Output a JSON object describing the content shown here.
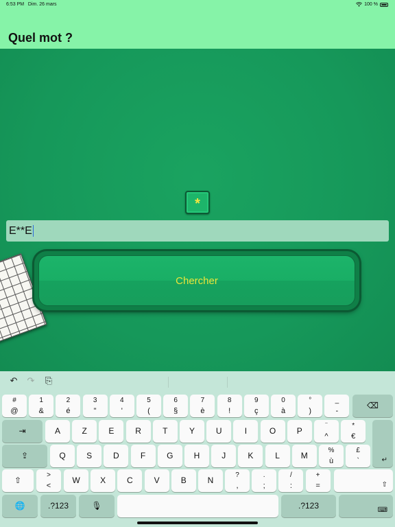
{
  "status": {
    "time": "6:53 PM",
    "date": "Dim. 26 mars",
    "battery": "100 %",
    "wifi_icon": "wifi-icon"
  },
  "nav": {
    "title": "Quel mot ?"
  },
  "star_button": {
    "label": "*"
  },
  "word_field": {
    "value": "E**E"
  },
  "search_button": {
    "label": "Chercher"
  },
  "colors": {
    "nav_bg": "#86f3a8",
    "felt": "#17995a",
    "button_text": "#e9e53a",
    "keyboard_bg": "#c4e6d8"
  },
  "toolbar": {
    "undo_icon": "↶",
    "redo_icon": "↷",
    "paste_icon": "⎘"
  },
  "keyboard": {
    "row1": [
      {
        "top": "#",
        "bottom": "@"
      },
      {
        "top": "1",
        "bottom": "&"
      },
      {
        "top": "2",
        "bottom": "é"
      },
      {
        "top": "3",
        "bottom": "\""
      },
      {
        "top": "4",
        "bottom": "'"
      },
      {
        "top": "5",
        "bottom": "("
      },
      {
        "top": "6",
        "bottom": "§"
      },
      {
        "top": "7",
        "bottom": "è"
      },
      {
        "top": "8",
        "bottom": "!"
      },
      {
        "top": "9",
        "bottom": "ç"
      },
      {
        "top": "0",
        "bottom": "à"
      },
      {
        "top": "°",
        "bottom": ")"
      },
      {
        "top": "_",
        "bottom": "-"
      }
    ],
    "row2": [
      "A",
      "Z",
      "E",
      "R",
      "T",
      "Y",
      "U",
      "I",
      "O",
      "P"
    ],
    "row2_extra": [
      {
        "top": "¨",
        "bottom": "^"
      },
      {
        "top": "*",
        "bottom": "€"
      }
    ],
    "row3": [
      "Q",
      "S",
      "D",
      "F",
      "G",
      "H",
      "J",
      "K",
      "L",
      "M"
    ],
    "row3_extra": [
      {
        "top": "%",
        "bottom": "ù"
      },
      {
        "top": "£",
        "bottom": "`"
      }
    ],
    "row4_extra_left": [
      {
        "top": ">",
        "bottom": "<"
      }
    ],
    "row4": [
      "W",
      "X",
      "C",
      "V",
      "B",
      "N"
    ],
    "row4_extra_right": [
      {
        "top": "?",
        "bottom": ","
      },
      {
        "top": ".",
        "bottom": ";"
      },
      {
        "top": "/",
        "bottom": ":"
      },
      {
        "top": "+",
        "bottom": "="
      }
    ],
    "numbers_label": ".?123",
    "icons": {
      "delete": "⌫",
      "tab": "⇥",
      "caps": "⇪",
      "return": "↵",
      "shift": "⇧",
      "globe": "🌐",
      "mic": "🎙",
      "hide": "⌨"
    }
  }
}
